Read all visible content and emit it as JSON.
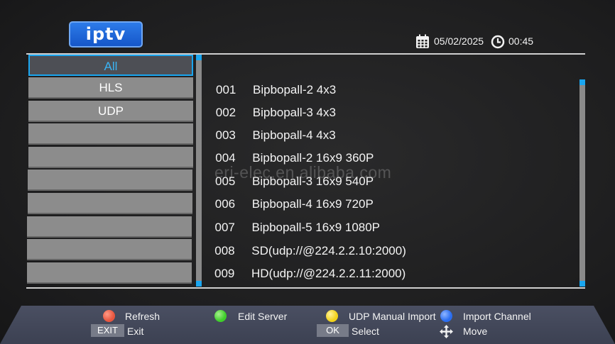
{
  "header": {
    "logo_text": "iptv",
    "date": "05/02/2025",
    "time": "00:45"
  },
  "categories": [
    {
      "label": "All",
      "selected": true
    },
    {
      "label": "HLS",
      "selected": false
    },
    {
      "label": "UDP",
      "selected": false
    },
    {
      "label": "",
      "selected": false
    },
    {
      "label": "",
      "selected": false
    },
    {
      "label": "",
      "selected": false
    },
    {
      "label": "",
      "selected": false
    },
    {
      "label": "",
      "selected": false
    },
    {
      "label": "",
      "selected": false
    },
    {
      "label": "",
      "selected": false
    }
  ],
  "channels": [
    {
      "num": "001",
      "name": "Bipbopall-2 4x3"
    },
    {
      "num": "002",
      "name": "Bipbopall-3 4x3"
    },
    {
      "num": "003",
      "name": "Bipbopall-4 4x3"
    },
    {
      "num": "004",
      "name": "Bipbopall-2 16x9 360P"
    },
    {
      "num": "005",
      "name": "Bipbopall-3 16x9 540P"
    },
    {
      "num": "006",
      "name": "Bipbopall-4 16x9 720P"
    },
    {
      "num": "007",
      "name": "Bipbopall-5 16x9 1080P"
    },
    {
      "num": "008",
      "name": "SD(udp://@224.2.2.10:2000)"
    },
    {
      "num": "009",
      "name": "HD(udp://@224.2.2.11:2000)"
    }
  ],
  "watermark": "eri-elec.en.alibaba.com",
  "footer": {
    "red_label": "Refresh",
    "green_label": "Edit Server",
    "yellow_label": "UDP Manual Import",
    "blue_label": "Import Channel",
    "exit_key": "EXIT",
    "exit_label": "Exit",
    "ok_key": "OK",
    "ok_label": "Select",
    "move_label": "Move"
  },
  "colors": {
    "accent": "#1aa6f0",
    "red": "#e8563f",
    "green": "#3fcf2a",
    "yellow": "#f2d21a",
    "blue": "#2a6df0"
  }
}
